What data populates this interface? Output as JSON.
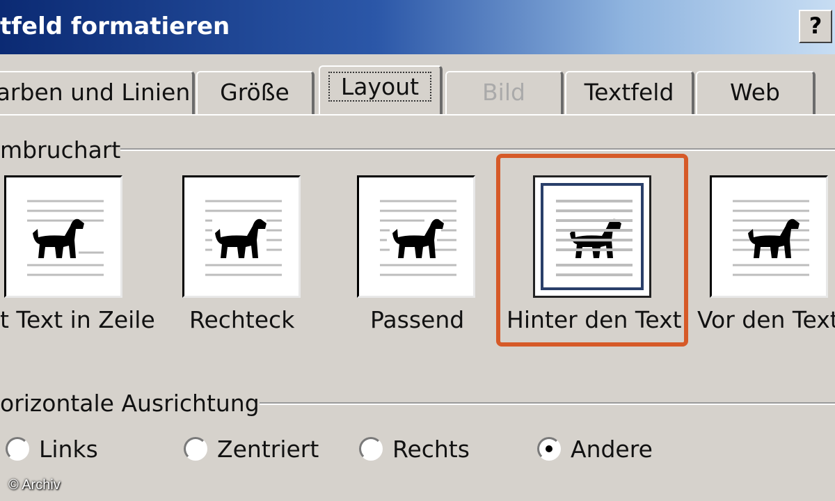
{
  "window": {
    "title": "tfeld formatieren",
    "help_label": "?"
  },
  "tabs": [
    {
      "label": "arben und Linien",
      "state": "normal"
    },
    {
      "label": "Größe",
      "state": "normal"
    },
    {
      "label": "Layout",
      "state": "active"
    },
    {
      "label": "Bild",
      "state": "disabled"
    },
    {
      "label": "Textfeld",
      "state": "normal"
    },
    {
      "label": "Web",
      "state": "normal"
    }
  ],
  "wrap_group": {
    "label": "mbruchart",
    "options": [
      {
        "label": "t Text in Zeile",
        "icon": "inline-text-dog-icon",
        "selected": false
      },
      {
        "label": "Rechteck",
        "icon": "square-wrap-dog-icon",
        "selected": false
      },
      {
        "label": "Passend",
        "icon": "tight-wrap-dog-icon",
        "selected": false
      },
      {
        "label": "Hinter den Text",
        "icon": "behind-text-dog-icon",
        "selected": true
      },
      {
        "label": "Vor den Text",
        "icon": "in-front-of-text-dog-icon",
        "selected": false
      }
    ]
  },
  "align_group": {
    "label": "orizontale Ausrichtung",
    "options": [
      {
        "label": "Links",
        "checked": false
      },
      {
        "label": "Zentriert",
        "checked": false
      },
      {
        "label": "Rechts",
        "checked": false
      },
      {
        "label": "Andere",
        "checked": true
      }
    ]
  },
  "colors": {
    "highlight": "#d65a28",
    "dialog_bg": "#d6d2cc",
    "title_gradient_start": "#0b2a73"
  },
  "watermark": "© Archiv"
}
